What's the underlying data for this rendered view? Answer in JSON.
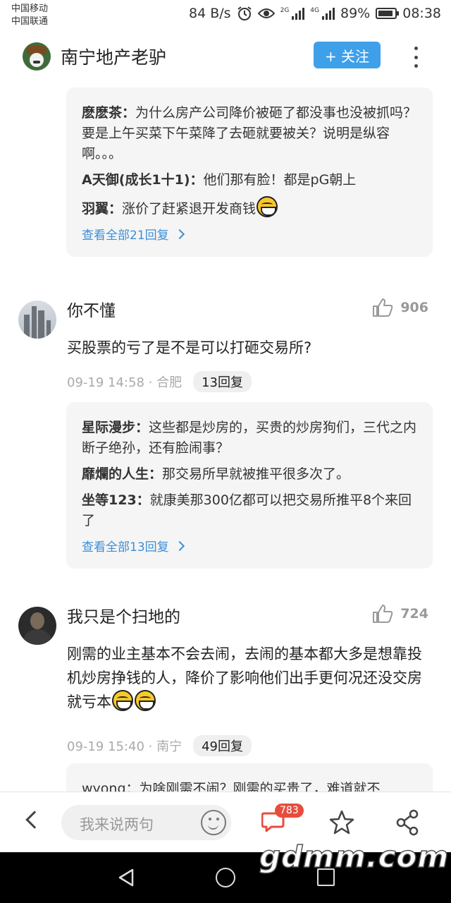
{
  "status_bar": {
    "carrier1": "中国移动",
    "carrier2": "中国联通",
    "speed": "84 B/s",
    "net1": "2G",
    "net2": "4G",
    "battery": "89%",
    "battery_level": 0.89,
    "time": "08:38"
  },
  "header": {
    "title": "南宁地产老驴",
    "follow_label": "+ 关注"
  },
  "reply_box_1": {
    "replies": [
      {
        "name": "麽麽茶：",
        "text": "为什么房产公司降价被砸了都没事也没被抓吗？要是上午买菜下午菜降了去砸就要被关？说明是纵容啊。。。"
      },
      {
        "name": "A天御(成长1十1)：",
        "text": "他们那有脸！都是pG朝上"
      },
      {
        "name": "羽翼：",
        "text": "涨价了赶紧退开发商钱"
      }
    ],
    "see_all": "查看全部21回复"
  },
  "comment_1": {
    "name": "你不懂",
    "likes": "906",
    "text": "买股票的亏了是不是可以打砸交易所?",
    "time": "09-19 14:58",
    "location": "合肥",
    "reply_count": "13回复"
  },
  "reply_box_2": {
    "replies": [
      {
        "name": "星际漫步：",
        "text": "这些都是炒房的，买贵的炒房狗们，三代之内断子绝孙，还有脸闹事？"
      },
      {
        "name": "靡爛的人生：",
        "text": "那交易所早就被推平很多次了。"
      },
      {
        "name": "坐等123：",
        "text": "就康美那300亿都可以把交易所推平8个来回了"
      }
    ],
    "see_all": "查看全部13回复"
  },
  "comment_2": {
    "name": "我只是个扫地的",
    "likes": "724",
    "text": "刚需的业主基本不会去闹，去闹的基本都大多是想靠投机炒房挣钱的人，降价了影响他们出手更何况还没交房就亏本",
    "time": "09-19 15:40",
    "location": "南宁",
    "reply_count": "49回复"
  },
  "reply_box_3": {
    "partial": "wyong：为啥刚需不闹？刚需的买贵了，难道就不"
  },
  "bottom_bar": {
    "input_placeholder": "我来说两句",
    "comment_count": "783"
  },
  "watermark": "gdmm.com"
}
